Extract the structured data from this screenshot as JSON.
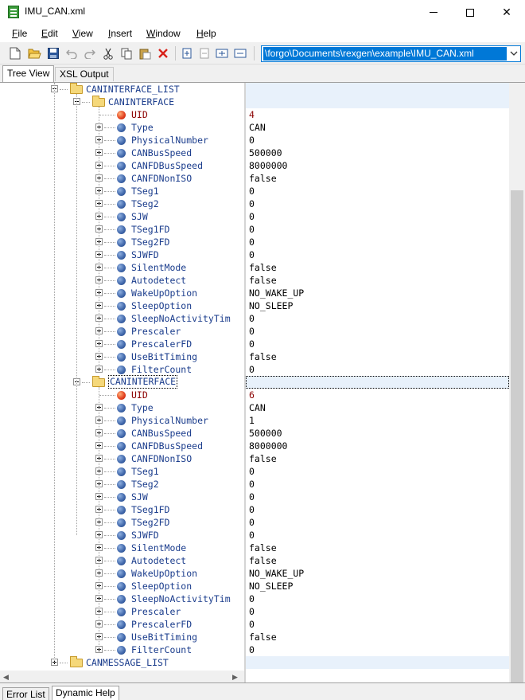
{
  "window": {
    "title": "IMU_CAN.xml"
  },
  "menu": {
    "items": [
      "File",
      "Edit",
      "View",
      "Insert",
      "Window",
      "Help"
    ]
  },
  "toolbar": {
    "buttons": [
      "new-file-icon",
      "open-folder-icon",
      "save-icon",
      "undo-icon",
      "redo-icon",
      "cut-icon",
      "copy-icon",
      "paste-icon",
      "delete-icon",
      "expand-icon",
      "collapse-icon",
      "expand-all-icon",
      "collapse-all-icon"
    ],
    "path": "\\forgo\\Documents\\rexgen\\example\\IMU_CAN.xml"
  },
  "tabs_top": [
    "Tree View",
    "XSL Output"
  ],
  "tree": {
    "root_label": "CANINTERFACE_LIST",
    "interfaces": [
      {
        "label": "CANINTERFACE",
        "fields": [
          {
            "name": "UID",
            "value": "4"
          },
          {
            "name": "Type",
            "value": "CAN"
          },
          {
            "name": "PhysicalNumber",
            "value": "0"
          },
          {
            "name": "CANBusSpeed",
            "value": "500000"
          },
          {
            "name": "CANFDBusSpeed",
            "value": "8000000"
          },
          {
            "name": "CANFDNonISO",
            "value": "false"
          },
          {
            "name": "TSeg1",
            "value": "0"
          },
          {
            "name": "TSeg2",
            "value": "0"
          },
          {
            "name": "SJW",
            "value": "0"
          },
          {
            "name": "TSeg1FD",
            "value": "0"
          },
          {
            "name": "TSeg2FD",
            "value": "0"
          },
          {
            "name": "SJWFD",
            "value": "0"
          },
          {
            "name": "SilentMode",
            "value": "false"
          },
          {
            "name": "Autodetect",
            "value": "false"
          },
          {
            "name": "WakeUpOption",
            "value": "NO_WAKE_UP"
          },
          {
            "name": "SleepOption",
            "value": "NO_SLEEP"
          },
          {
            "name": "SleepNoActivityTim",
            "value": "0"
          },
          {
            "name": "Prescaler",
            "value": "0"
          },
          {
            "name": "PrescalerFD",
            "value": "0"
          },
          {
            "name": "UseBitTiming",
            "value": "false"
          },
          {
            "name": "FilterCount",
            "value": "0"
          }
        ]
      },
      {
        "label": "CANINTERFACE",
        "fields": [
          {
            "name": "UID",
            "value": "6"
          },
          {
            "name": "Type",
            "value": "CAN"
          },
          {
            "name": "PhysicalNumber",
            "value": "1"
          },
          {
            "name": "CANBusSpeed",
            "value": "500000"
          },
          {
            "name": "CANFDBusSpeed",
            "value": "8000000"
          },
          {
            "name": "CANFDNonISO",
            "value": "false"
          },
          {
            "name": "TSeg1",
            "value": "0"
          },
          {
            "name": "TSeg2",
            "value": "0"
          },
          {
            "name": "SJW",
            "value": "0"
          },
          {
            "name": "TSeg1FD",
            "value": "0"
          },
          {
            "name": "TSeg2FD",
            "value": "0"
          },
          {
            "name": "SJWFD",
            "value": "0"
          },
          {
            "name": "SilentMode",
            "value": "false"
          },
          {
            "name": "Autodetect",
            "value": "false"
          },
          {
            "name": "WakeUpOption",
            "value": "NO_WAKE_UP"
          },
          {
            "name": "SleepOption",
            "value": "NO_SLEEP"
          },
          {
            "name": "SleepNoActivityTim",
            "value": "0"
          },
          {
            "name": "Prescaler",
            "value": "0"
          },
          {
            "name": "PrescalerFD",
            "value": "0"
          },
          {
            "name": "UseBitTiming",
            "value": "false"
          },
          {
            "name": "FilterCount",
            "value": "0"
          }
        ]
      }
    ],
    "message_list_label": "CANMESSAGE_LIST"
  },
  "tabs_bottom": [
    "Error List",
    "Dynamic Help"
  ],
  "colors": {
    "accent": "#0078d7",
    "uid_dot": "#e03c1c",
    "field_dot": "#3d64a8",
    "folder": "#f5d87a"
  }
}
